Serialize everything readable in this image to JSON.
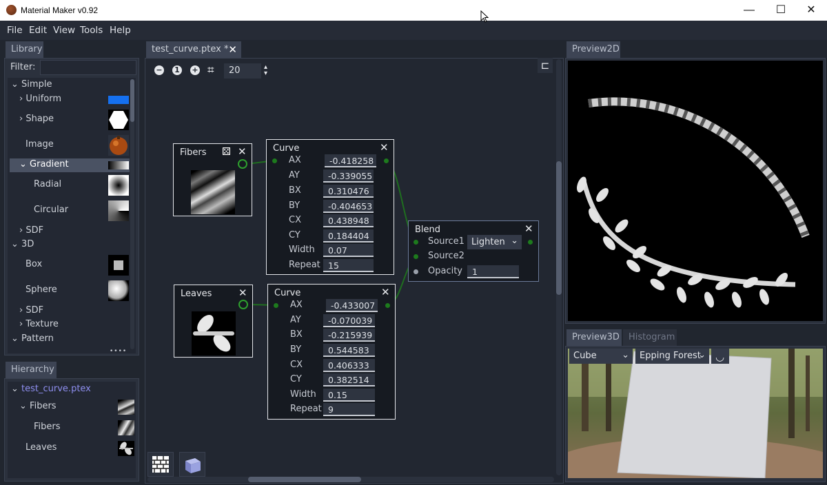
{
  "window": {
    "title": "Material Maker v0.92",
    "minimize": "—",
    "maximize": "☐",
    "close": "✕"
  },
  "menu": [
    "File",
    "Edit",
    "View",
    "Tools",
    "Help"
  ],
  "library": {
    "tab": "Library",
    "filter_label": "Filter:",
    "filter_value": "",
    "items": [
      {
        "label": "Simple",
        "expander": "⌄"
      },
      {
        "label": "Uniform",
        "expander": "›"
      },
      {
        "label": "Shape",
        "expander": "›"
      },
      {
        "label": "Image",
        "expander": ""
      },
      {
        "label": "Gradient",
        "expander": "⌄"
      },
      {
        "label": "Radial",
        "expander": ""
      },
      {
        "label": "Circular",
        "expander": ""
      },
      {
        "label": "SDF",
        "expander": "›"
      },
      {
        "label": "3D",
        "expander": "⌄"
      },
      {
        "label": "Box",
        "expander": ""
      },
      {
        "label": "Sphere",
        "expander": ""
      },
      {
        "label": "SDF",
        "expander": "›"
      },
      {
        "label": "Texture",
        "expander": "›"
      },
      {
        "label": "Pattern",
        "expander": "⌄"
      }
    ],
    "more": "••••"
  },
  "hierarchy": {
    "tab": "Hierarchy",
    "items": [
      {
        "label": "test_curve.ptex",
        "expander": "⌄"
      },
      {
        "label": "Fibers",
        "expander": "⌄"
      },
      {
        "label": "Fibers",
        "expander": ""
      },
      {
        "label": "Leaves",
        "expander": ""
      }
    ]
  },
  "graph": {
    "tab": "test_curve.ptex *",
    "tab_close": "✕",
    "zoom_out": "−",
    "zoom_reset": "1",
    "zoom_in": "+",
    "grid_icon": "⌗",
    "snap_value": "20",
    "spin": "▴▾",
    "align_icon": "⊏"
  },
  "nodes": {
    "fibers": {
      "title": "Fibers",
      "close": "✕",
      "dice": "⚄"
    },
    "leaves": {
      "title": "Leaves",
      "close": "✕"
    },
    "curve1": {
      "title": "Curve",
      "close": "✕",
      "params": [
        {
          "label": "AX",
          "value": "-0.418258"
        },
        {
          "label": "AY",
          "value": "-0.339055"
        },
        {
          "label": "BX",
          "value": "0.310476"
        },
        {
          "label": "BY",
          "value": "-0.404653"
        },
        {
          "label": "CX",
          "value": "0.438948"
        },
        {
          "label": "CY",
          "value": "0.184404"
        },
        {
          "label": "Width",
          "value": "0.07"
        },
        {
          "label": "Repeat",
          "value": "15"
        }
      ]
    },
    "curve2": {
      "title": "Curve",
      "close": "✕",
      "params": [
        {
          "label": "AX",
          "value": "-0.433007"
        },
        {
          "label": "AY",
          "value": "-0.070039"
        },
        {
          "label": "BX",
          "value": "-0.215939"
        },
        {
          "label": "BY",
          "value": "0.544583"
        },
        {
          "label": "CX",
          "value": "0.406333"
        },
        {
          "label": "CY",
          "value": "0.382514"
        },
        {
          "label": "Width",
          "value": "0.15"
        },
        {
          "label": "Repeat",
          "value": "9"
        }
      ]
    },
    "blend": {
      "title": "Blend",
      "close": "✕",
      "source1": "Source1",
      "mode": "Lighten",
      "dropdown_arrow": "⌄",
      "source2": "Source2",
      "opacity_label": "Opacity",
      "opacity_value": "1"
    }
  },
  "preview2d": {
    "tab": "Preview2D"
  },
  "preview3d": {
    "tab": "Preview3D",
    "tab_histogram": "Histogram",
    "model": "Cube",
    "environment": "Epping Forest",
    "arrow": "⌄",
    "rotate_icon": "◡"
  },
  "colors": {
    "port": "#1d7a1d",
    "port_ring": "#2ea02e",
    "link": "#1f6e1f",
    "uniform": "#1570f0",
    "hier_root": "#8f8ff0"
  }
}
